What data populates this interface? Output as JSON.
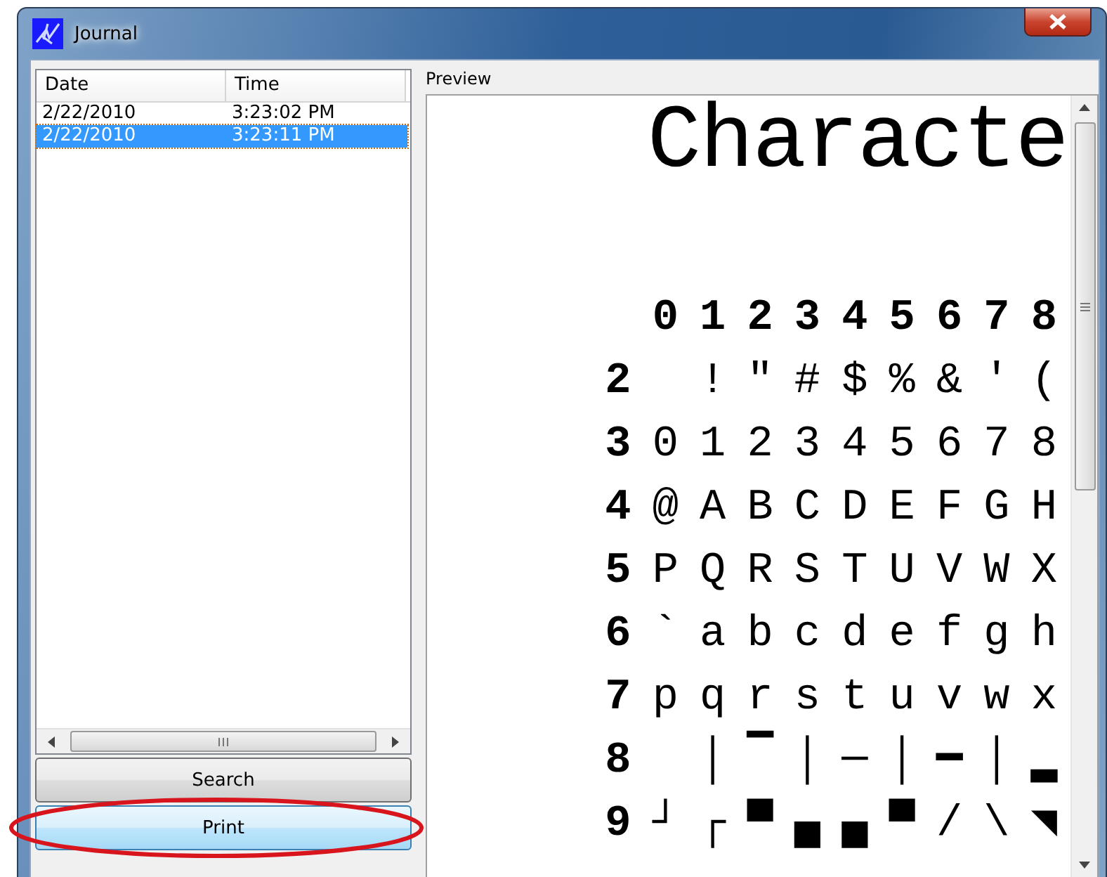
{
  "window": {
    "title": "Journal"
  },
  "journal_list": {
    "columns": [
      "Date",
      "Time"
    ],
    "rows": [
      {
        "date": "2/22/2010",
        "time": "3:23:02 PM",
        "selected": false
      },
      {
        "date": "2/22/2010",
        "time": "3:23:11 PM",
        "selected": true
      }
    ]
  },
  "buttons": [
    {
      "label": "Search",
      "hovered": false,
      "highlighted": false
    },
    {
      "label": "Print",
      "hovered": true,
      "highlighted": true
    }
  ],
  "preview": {
    "label": "Preview",
    "heading": "Characte",
    "column_headers": [
      "0",
      "1",
      "2",
      "3",
      "4",
      "5",
      "6",
      "7",
      "8"
    ],
    "rows": [
      {
        "label": "2",
        "cells": [
          null,
          "!",
          "\"",
          "#",
          "$",
          "%",
          "&",
          "'",
          "("
        ]
      },
      {
        "label": "3",
        "cells": [
          "0",
          "1",
          "2",
          "3",
          "4",
          "5",
          "6",
          "7",
          "8"
        ]
      },
      {
        "label": "4",
        "cells": [
          "@",
          "A",
          "B",
          "C",
          "D",
          "E",
          "F",
          "G",
          "H"
        ]
      },
      {
        "label": "5",
        "cells": [
          "P",
          "Q",
          "R",
          "S",
          "T",
          "U",
          "V",
          "W",
          "X"
        ]
      },
      {
        "label": "6",
        "cells": [
          "`",
          "a",
          "b",
          "c",
          "d",
          "e",
          "f",
          "g",
          "h"
        ]
      },
      {
        "label": "7",
        "cells": [
          "p",
          "q",
          "r",
          "s",
          "t",
          "u",
          "v",
          "w",
          "x"
        ]
      },
      {
        "label": "8",
        "cells": [
          null,
          "│",
          "▔",
          "│",
          "─",
          "│",
          "━",
          "│",
          "▂"
        ]
      },
      {
        "label": "9",
        "cells": [
          "┘",
          "┌",
          "▀",
          "▄",
          "▄",
          "▀",
          "/",
          "\\",
          "◥"
        ]
      }
    ]
  }
}
